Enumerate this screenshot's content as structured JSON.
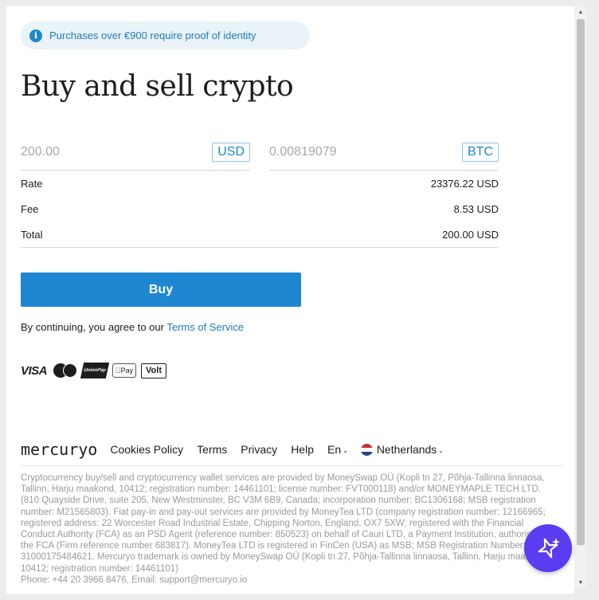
{
  "banner": {
    "text": "Purchases over €900 require proof of identity"
  },
  "title": "Buy and sell crypto",
  "exchange": {
    "from_amount": "200.00",
    "from_currency": "USD",
    "to_amount": "0.00819079",
    "to_currency": "BTC"
  },
  "summary": {
    "rate_label": "Rate",
    "rate_value": "23376.22 USD",
    "fee_label": "Fee",
    "fee_value": "8.53 USD",
    "total_label": "Total",
    "total_value": "200.00 USD"
  },
  "buy_label": "Buy",
  "agreement": {
    "prefix": "By continuing, you agree to our ",
    "link": "Terms of Service"
  },
  "payments": {
    "visa": "VISA",
    "unionpay": "UnionPay",
    "applepay": " Pay",
    "volt": "Volt"
  },
  "footer": {
    "logo": "mercuryo",
    "links": [
      "Cookies Policy",
      "Terms",
      "Privacy",
      "Help"
    ],
    "language": "En",
    "country": "Netherlands"
  },
  "legal": "Cryptocurrency buy/sell and cryptocurrency wallet services are provided by MoneySwap OÜ (Kopli tn 27, Põhja-Tallinna linnaosa, Tallinn, Harju maakond, 10412; registration number: 14461101; license number: FVT000118) and/or MONEYMAPLE TECH LTD. (810 Quayside Drive, suite 205, New Westminster, BC V3M 6B9, Canada; incorporation number: BC1306168; MSB registration number: M21565803). Fiat pay-in and pay-out services are provided by MoneyTea LTD (company registration number: 12166965; registered address: 22 Worcester Road Industrial Estate, Chipping Norton, England, OX7 5XW; registered with the Financial Conduct Authority (FCA) as an PSD Agent (reference number: 850523) on behalf of Cauri LTD, a Payment Institution, authorised by the FCA (Firm reference number 683817). MoneyTea LTD is registered in FinCen (USA) as MSB; MSB Registration Number: 31000175484621. Mercuryo trademark is owned by MoneySwap OÜ (Kopli tn 27, Põhja-Tallinna linnaosa, Tallinn, Harju maakond, 10412; registration number: 14461101)",
  "contact": "Phone: +44 20 3966 8476, Email: support@mercuryo.io",
  "colors": {
    "accent": "#1d87d1",
    "assistant": "#5b3cf0"
  }
}
